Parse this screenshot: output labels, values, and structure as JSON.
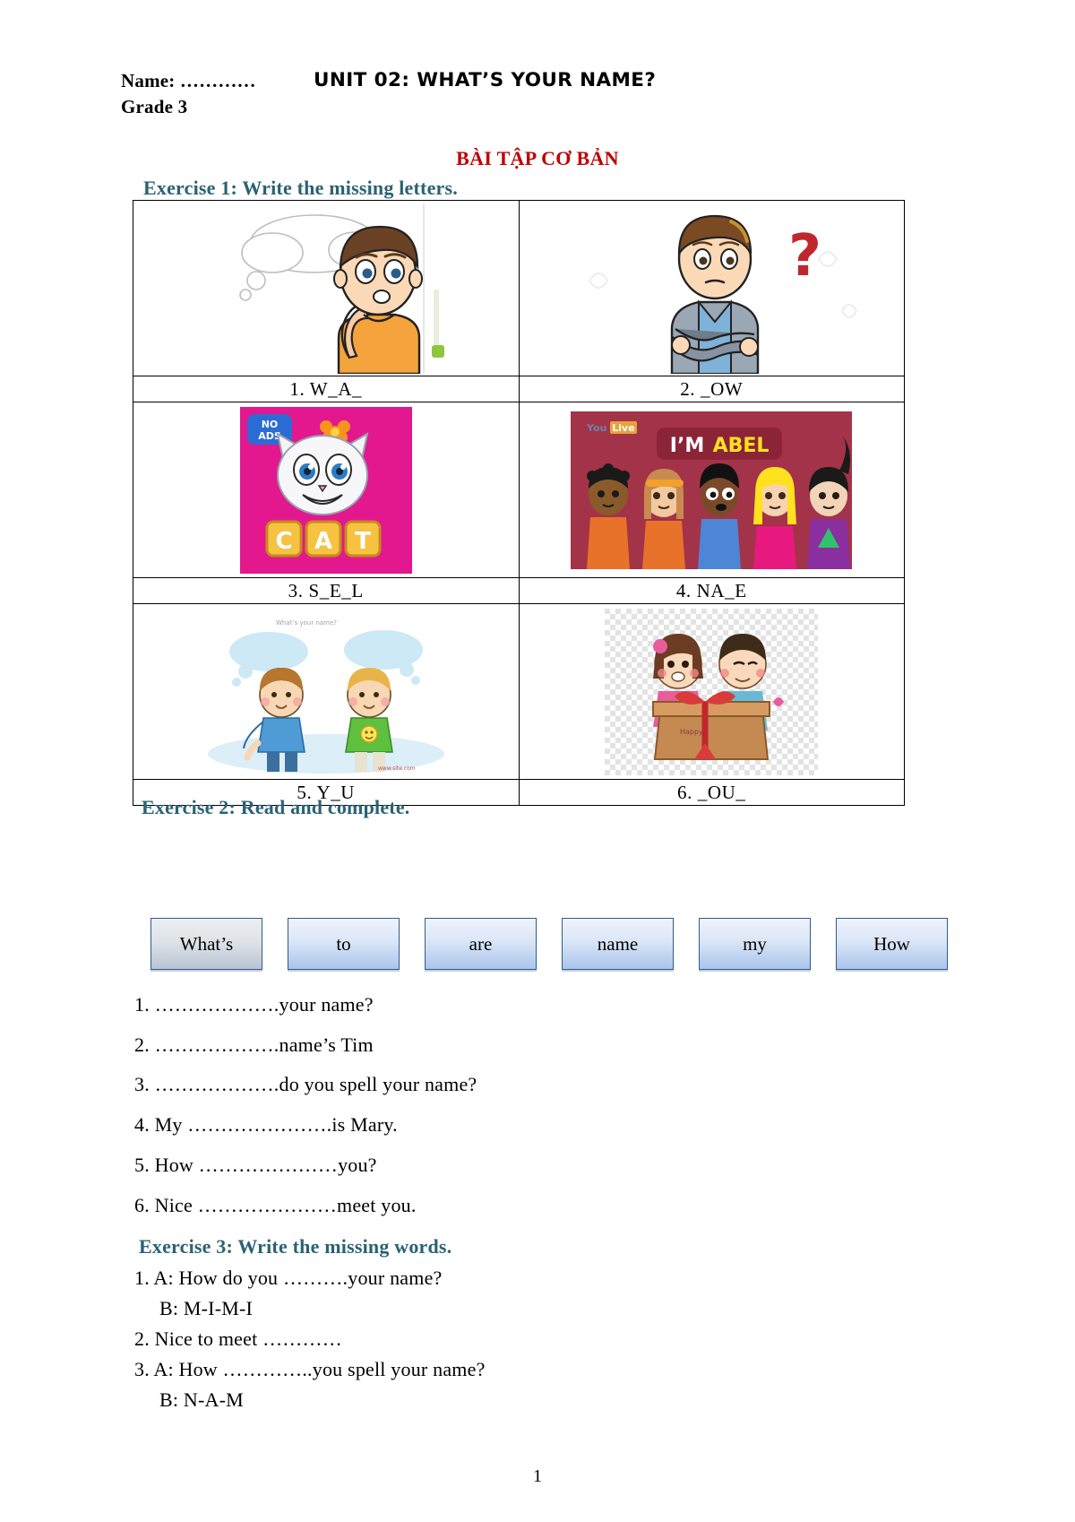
{
  "header": {
    "name_label": "Name: …………",
    "grade_label": "Grade 3",
    "unit_title": "UNIT 02: WHAT’S YOUR NAME?",
    "section_title": "BÀI TẬP CƠ BẢN",
    "section_title_color": "#C00000",
    "heading_color": "#2A6274"
  },
  "exercise1": {
    "heading": "Exercise 1: Write the missing letters.",
    "items": [
      {
        "number": "1.",
        "answer_blank": "W_A_",
        "caption": "1. W_A_",
        "image_name": "boy-thinking-thought-bubble"
      },
      {
        "number": "2.",
        "answer_blank": "_OW",
        "caption": "2. _OW",
        "image_name": "boy-with-question-mark"
      },
      {
        "number": "3.",
        "answer_blank": "S_E_L",
        "caption": "3. S_E_L",
        "image_name": "cat-blocks-no-ads"
      },
      {
        "number": "4.",
        "answer_blank": "NA_E",
        "caption": "4. NA_E",
        "image_name": "im-abel-kids-group"
      },
      {
        "number": "5.",
        "answer_blank": "Y_U",
        "caption": "5. Y_U",
        "image_name": "two-boys-talking-thought-bubbles"
      },
      {
        "number": "6.",
        "answer_blank": "_OU_",
        "caption": "6. _OU_",
        "image_name": "two-kids-with-gift-box"
      }
    ],
    "picture_texts": {
      "no_ads": "NO\nADS",
      "cat_letters": [
        "C",
        "A",
        "T"
      ],
      "im_abel_white": "I’M",
      "im_abel_yellow": "ABEL",
      "youlive_brand": "You Live",
      "bubble_question": "What's your name?"
    }
  },
  "exercise2": {
    "heading": "Exercise 2: Read and complete.",
    "word_bank": [
      "What’s",
      "to",
      "are",
      "name",
      "my",
      "How"
    ],
    "sentences": [
      "1. ……………….your name?",
      "2. ……………….name’s Tim",
      "3. ……………….do you spell your name?",
      "4. My ………………….is Mary.",
      "5. How …………………you?",
      "6. Nice …………………meet you."
    ]
  },
  "exercise3": {
    "heading": "Exercise 3: Write the missing words.",
    "lines": [
      {
        "text": "1. A: How do you ……….your name?",
        "indent": false
      },
      {
        "text": "B: M-I-M-I",
        "indent": true
      },
      {
        "text": "2. Nice to meet …………",
        "indent": false
      },
      {
        "text": "3. A: How …………..you spell your name?",
        "indent": false
      },
      {
        "text": "B: N-A-M",
        "indent": true
      }
    ]
  },
  "footer": {
    "page_number": "1"
  }
}
